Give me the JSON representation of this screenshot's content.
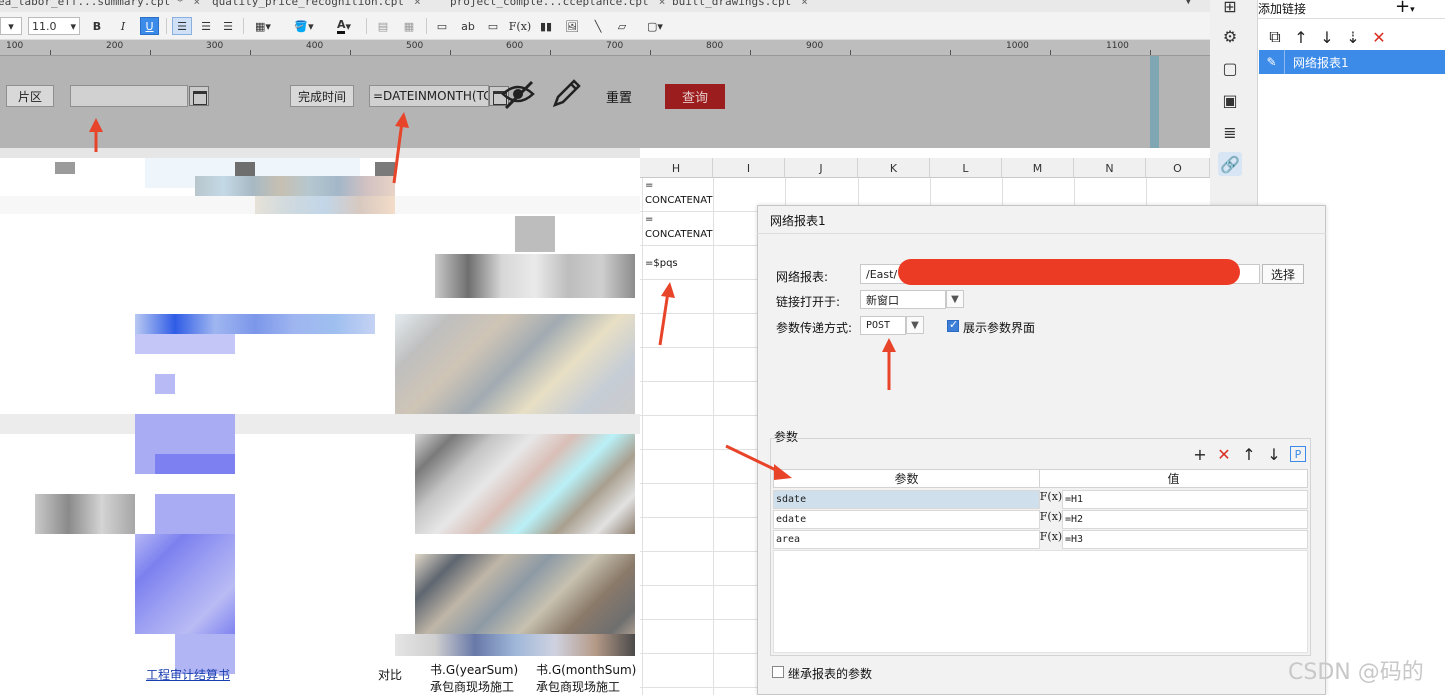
{
  "tabs": [
    {
      "label": "ea_labor_eff...summary.cpt *"
    },
    {
      "label": "quality_price_recognition.cpt"
    },
    {
      "label": "project_comple...cceptance.cpt"
    },
    {
      "label": "built_drawings.cpt"
    }
  ],
  "toolbar": {
    "zoom_value": "100",
    "font_size": "11.0",
    "bold": "B",
    "italic": "I",
    "underline": "U",
    "ab": "ab",
    "fx": "F(x)",
    "font_color": "A"
  },
  "ruler": {
    "ticks": [
      "100",
      "200",
      "300",
      "400",
      "500",
      "600",
      "700",
      "800",
      "900",
      "1000",
      "1100",
      "1200"
    ]
  },
  "param_panel": {
    "area_label": "片区",
    "area_value": "",
    "finish_time_label": "完成时间",
    "finish_time_value": "=DATEINMONTH(TC",
    "reset_label": "重置",
    "query_label": "查询"
  },
  "grid": {
    "columns": [
      "H",
      "I",
      "J",
      "K",
      "L",
      "M",
      "N",
      "O"
    ],
    "cells": {
      "h1_prefix": "=",
      "h1_text": "CONCATENAT",
      "h2_prefix": "=",
      "h2_text": "CONCATENAT",
      "h3_text": "=$pqs"
    },
    "bottom_labels": [
      "工程审计结算书",
      "对比",
      "书.G(yearSum)",
      "书.G(monthSum)",
      "承包商现场施工",
      "承包商现场施工"
    ]
  },
  "right_panel": {
    "title": "添加链接",
    "add_label": "+",
    "links": [
      "网络报表1"
    ]
  },
  "dialog": {
    "title": "网络报表1",
    "report_label": "网络报表:",
    "report_value": "/East/",
    "select_button": "选择",
    "open_in_label": "链接打开于:",
    "open_in_value": "新窗口",
    "pass_method_label": "参数传递方式:",
    "pass_method_value": "POST",
    "show_param_label": "展示参数界面",
    "show_param_checked": true,
    "params_section": "参数",
    "table_header_param": "参数",
    "table_header_value": "值",
    "rows": [
      {
        "param": "sdate",
        "fx": "F(x)",
        "value": "=H1"
      },
      {
        "param": "edate",
        "fx": "F(x)",
        "value": "=H2"
      },
      {
        "param": "area",
        "fx": "F(x)",
        "value": "=H3"
      }
    ],
    "inherit_label": "继承报表的参数",
    "inherit_checked": false
  },
  "watermark": "CSDN @码的",
  "colors": {
    "accent_blue": "#3d8be8",
    "query_red": "#9b1d1d",
    "arrow_red": "#e8442a",
    "panel_gray": "#b4b4b4"
  }
}
